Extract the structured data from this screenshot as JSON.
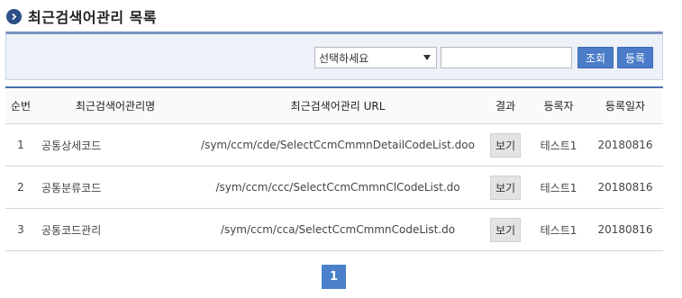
{
  "page": {
    "title": "최근검색어관리 목록"
  },
  "search": {
    "select_value": "선택하세요",
    "input_value": "",
    "search_label": "조회",
    "register_label": "등록"
  },
  "table": {
    "headers": {
      "no": "순번",
      "name": "최근검색어관리명",
      "url": "최근검색어관리 URL",
      "result": "결과",
      "registrant": "등록자",
      "date": "등록일자"
    },
    "rows": [
      {
        "no": "1",
        "name": "공통상세코드",
        "url": "/sym/ccm/cde/SelectCcmCmmnDetailCodeList.doo",
        "result": "보기",
        "registrant": "테스트1",
        "date": "20180816"
      },
      {
        "no": "2",
        "name": "공통분류코드",
        "url": "/sym/ccm/ccc/SelectCcmCmmnClCodeList.do",
        "result": "보기",
        "registrant": "테스트1",
        "date": "20180816"
      },
      {
        "no": "3",
        "name": "공통코드관리",
        "url": "/sym/ccm/cca/SelectCcmCmmnCodeList.do",
        "result": "보기",
        "registrant": "테스트1",
        "date": "20180816"
      }
    ]
  },
  "pagination": {
    "current": "1"
  }
}
